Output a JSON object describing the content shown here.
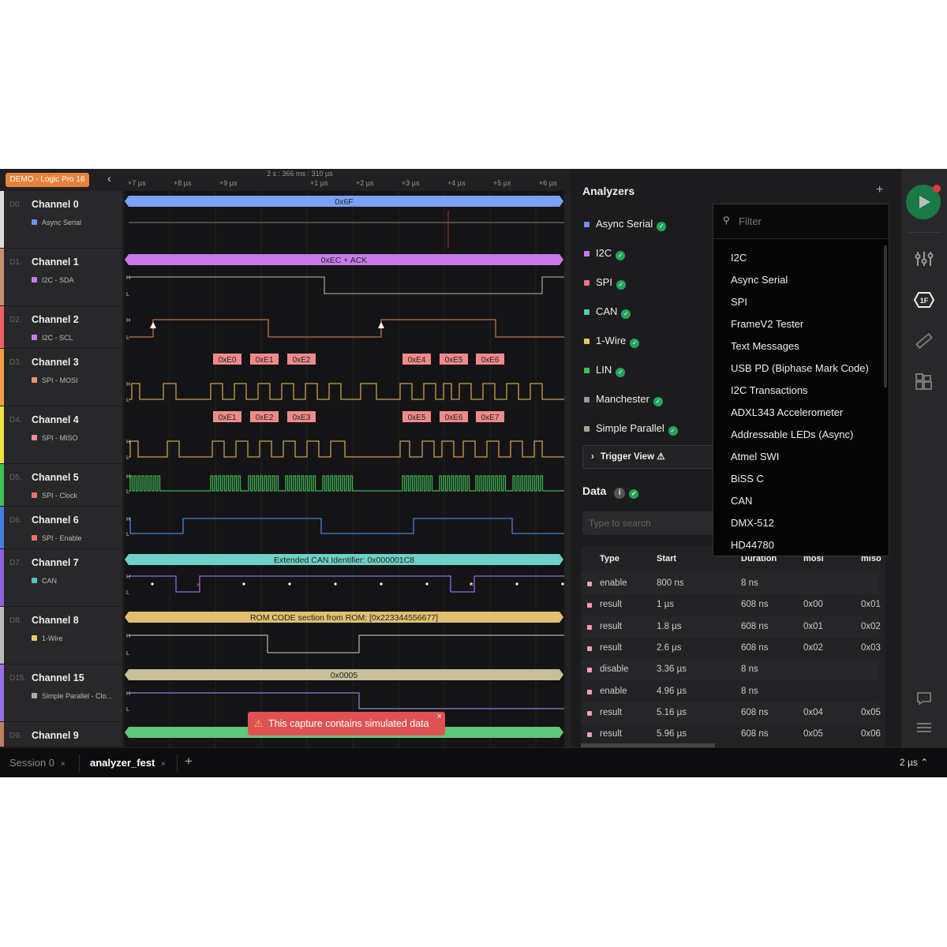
{
  "device_badge": "DEMO - Logic Pro 16",
  "time_center": "2 s : 366 ms : 310 µs",
  "time_ticks": [
    "+7 µs",
    "+8 µs",
    "+9 µs",
    "+1 µs",
    "+2 µs",
    "+3 µs",
    "+4 µs",
    "+5 µs",
    "+6 µs"
  ],
  "channels": [
    {
      "id": "D0.",
      "name": "Channel 0",
      "analyzer": "Async Serial",
      "color": "#dddddd",
      "dot": "#6f8ff0",
      "bar": "0x6F",
      "bar_color": "#7aa2f7"
    },
    {
      "id": "D1.",
      "name": "Channel 1",
      "analyzer": "I2C - SDA",
      "color": "#c59070",
      "dot": "#c77be8",
      "bar": "0xEC + ACK",
      "bar_color": "#c77be8"
    },
    {
      "id": "D2.",
      "name": "Channel 2",
      "analyzer": "I2C - SCL",
      "color": "#f06060",
      "dot": "#c77be8"
    },
    {
      "id": "D3.",
      "name": "Channel 3",
      "analyzer": "SPI - MOSI",
      "color": "#f5a040",
      "dot": "#f0907a",
      "bytes": [
        "0xE0",
        "0xE1",
        "0xE2",
        "0xE4",
        "0xE5",
        "0xE6"
      ]
    },
    {
      "id": "D4.",
      "name": "Channel 4",
      "analyzer": "SPI - MISO",
      "color": "#f0e040",
      "dot": "#f08a9a",
      "bytes": [
        "0xE1",
        "0xE2",
        "0xE3",
        "0xE5",
        "0xE6",
        "0xE7"
      ]
    },
    {
      "id": "D5.",
      "name": "Channel 5",
      "analyzer": "SPI - Clock",
      "color": "#40c050",
      "dot": "#f07070"
    },
    {
      "id": "D6.",
      "name": "Channel 6",
      "analyzer": "SPI - Enable",
      "color": "#4080e0",
      "dot": "#f07070"
    },
    {
      "id": "D7.",
      "name": "Channel 7",
      "analyzer": "CAN",
      "color": "#9060e0",
      "dot": "#50c8b8",
      "bar": "Extended CAN Identifier: 0x000001C8",
      "bar_color": "#6fd0c8"
    },
    {
      "id": "D8.",
      "name": "Channel 8",
      "analyzer": "1-Wire",
      "color": "#bbbbbb",
      "dot": "#e8c860",
      "bar": "ROM CODE section from ROM: [0x223344556677]",
      "bar_color": "#e0c070"
    },
    {
      "id": "D15.",
      "name": "Channel 15",
      "analyzer": "Simple Parallel - Clo...",
      "color": "#9a70e8",
      "dot": "#aaaaaa",
      "bar": "0x0005",
      "bar_color": "#c8c098"
    },
    {
      "id": "D9.",
      "name": "Channel 9",
      "analyzer": "",
      "color": "#c08060",
      "dot": "#888",
      "bar": "",
      "bar_color": "#60c878"
    }
  ],
  "toast": "This capture contains simulated data",
  "analyzers": {
    "title": "Analyzers",
    "add": "+",
    "items": [
      {
        "label": "Async Serial",
        "color": "#6f8ff0"
      },
      {
        "label": "I2C",
        "color": "#c77be8"
      },
      {
        "label": "SPI",
        "color": "#f07080"
      },
      {
        "label": "CAN",
        "color": "#50c8b8"
      },
      {
        "label": "1-Wire",
        "color": "#e8c860"
      },
      {
        "label": "LIN",
        "color": "#40c060"
      },
      {
        "label": "Manchester",
        "color": "#999999"
      },
      {
        "label": "Simple Parallel",
        "color": "#a0a890"
      }
    ],
    "trigger_view": "Trigger View ⚠"
  },
  "dropdown": {
    "filter_placeholder": "Filter",
    "items": [
      "I2C",
      "Async Serial",
      "SPI",
      "FrameV2 Tester",
      "Text Messages",
      "USB PD (Biphase Mark Code)",
      "I2C Transactions",
      "ADXL343 Accelerometer",
      "Addressable LEDs (Async)",
      "Atmel SWI",
      "BiSS C",
      "CAN",
      "DMX-512",
      "HD44780"
    ]
  },
  "data": {
    "title": "Data",
    "search_placeholder": "Type to search",
    "columns": [
      "Type",
      "Start",
      "Duration",
      "mosi",
      "miso"
    ],
    "rows": [
      [
        "enable",
        "800 ns",
        "8 ns",
        "",
        ""
      ],
      [
        "result",
        "1 µs",
        "608 ns",
        "0x00",
        "0x01"
      ],
      [
        "result",
        "1.8 µs",
        "608 ns",
        "0x01",
        "0x02"
      ],
      [
        "result",
        "2.6 µs",
        "608 ns",
        "0x02",
        "0x03"
      ],
      [
        "disable",
        "3.36 µs",
        "8 ns",
        "",
        ""
      ],
      [
        "enable",
        "4.96 µs",
        "8 ns",
        "",
        ""
      ],
      [
        "result",
        "5.16 µs",
        "608 ns",
        "0x04",
        "0x05"
      ],
      [
        "result",
        "5.96 µs",
        "608 ns",
        "0x05",
        "0x06"
      ]
    ]
  },
  "tabs": [
    {
      "label": "Session 0",
      "active": false
    },
    {
      "label": "analyzer_fest",
      "active": true
    }
  ],
  "timescale": "2 µs ⌃"
}
